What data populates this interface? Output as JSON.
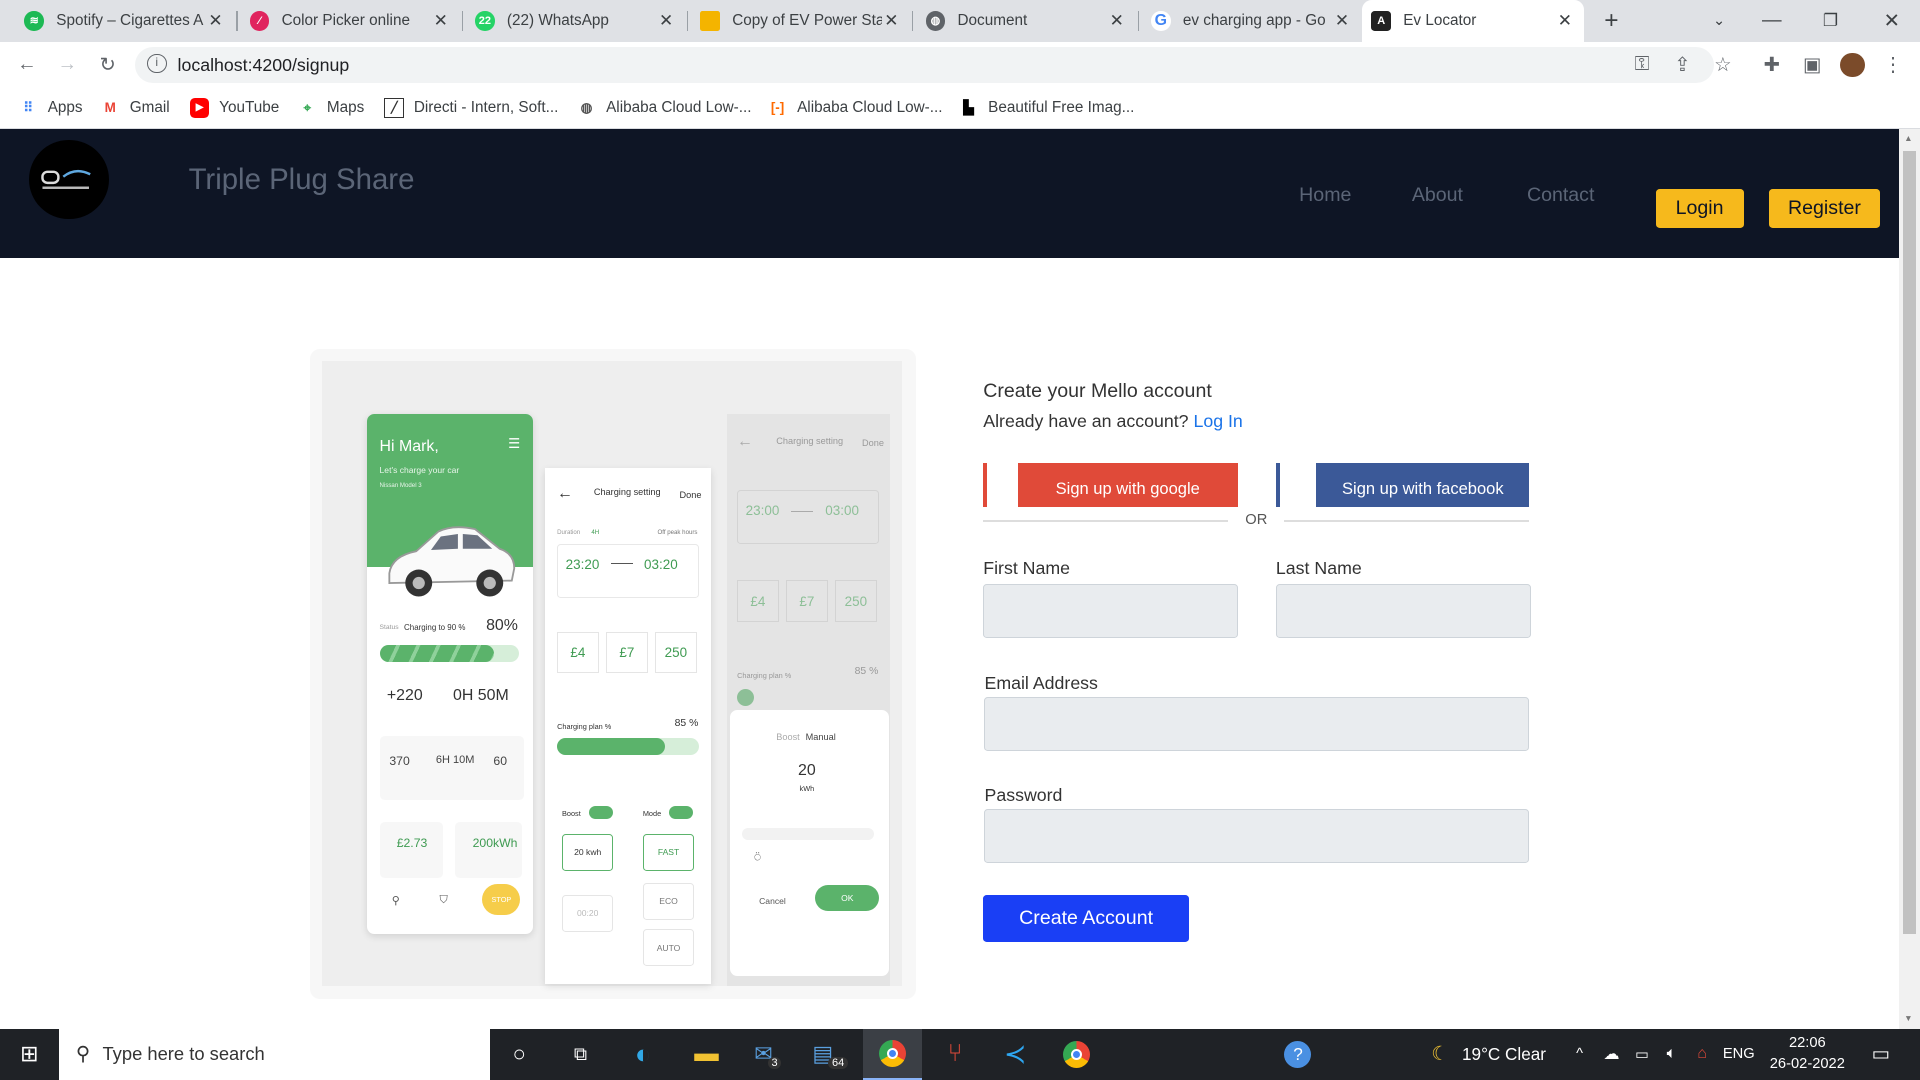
{
  "browser": {
    "tabs": [
      {
        "title": "Spotify – Cigarettes A",
        "icon": "spotify-icon",
        "color": "#1db954"
      },
      {
        "title": "Color Picker online",
        "icon": "color-picker-icon",
        "color": "#e0245e"
      },
      {
        "title": "(22) WhatsApp",
        "icon": "whatsapp-icon",
        "color": "#25d366",
        "badge": "22"
      },
      {
        "title": "Copy of EV Power Sta",
        "icon": "slides-icon",
        "color": "#f4b400"
      },
      {
        "title": "Document",
        "icon": "globe-icon",
        "color": "#5f6368"
      },
      {
        "title": "ev charging app - Go",
        "icon": "google-icon",
        "color": "#4285f4"
      },
      {
        "title": "Ev Locator",
        "icon": "angular-icon",
        "color": "#222"
      }
    ],
    "url": "localhost:4200/signup",
    "bookmarks": [
      {
        "label": "Apps",
        "icon": "apps-grid-icon"
      },
      {
        "label": "Gmail",
        "icon": "gmail-icon"
      },
      {
        "label": "YouTube",
        "icon": "youtube-icon"
      },
      {
        "label": "Maps",
        "icon": "maps-icon"
      },
      {
        "label": "Directi - Intern, Soft...",
        "icon": "directi-icon"
      },
      {
        "label": "Alibaba Cloud Low-...",
        "icon": "globe-icon"
      },
      {
        "label": "Alibaba Cloud Low-...",
        "icon": "alibaba-icon"
      },
      {
        "label": "Beautiful Free Imag...",
        "icon": "unsplash-icon"
      }
    ]
  },
  "app": {
    "brand": "Triple Plug Share",
    "nav": {
      "home": "Home",
      "about": "About",
      "contact": "Contact"
    },
    "login_label": "Login",
    "register_label": "Register"
  },
  "illustration": {
    "phone1": {
      "greeting": "Hi Mark,",
      "subtitle": "Let's charge your car",
      "car_model": "Nissan Model 3",
      "status_label": "Status",
      "status_text": "Charging to 90 %",
      "percent": "80%",
      "range_added": "+220",
      "time_left": "0H 50M",
      "stats": [
        "370",
        "6H 10M",
        "60"
      ],
      "cost": "£2.73",
      "energy": "200kWh",
      "stop_label": "STOP"
    },
    "phone2": {
      "title": "Charging setting",
      "done": "Done",
      "duration_label": "Duration",
      "duration": "4H",
      "offpeak": "Off peak hours",
      "start_time": "23:20",
      "end_time": "03:20",
      "prices": [
        "£4",
        "£7",
        "250"
      ],
      "plan_label": "Charging plan %",
      "plan_value": "85 %",
      "boost_label": "Boost",
      "mode_label": "Mode",
      "kwh_box": "20 kwh",
      "fast": "FAST",
      "eco": "ECO",
      "auto": "AUTO",
      "manual_time": "00:20"
    },
    "phone3": {
      "title": "Charging setting",
      "done": "Done",
      "start_time": "23:00",
      "end_time": "03:00",
      "prices": [
        "£4",
        "£7",
        "250"
      ],
      "plan_label": "Charging plan %",
      "plan_value": "85 %",
      "dialog_boost": "Boost",
      "dialog_manual": "Manual",
      "dialog_value": "20",
      "dialog_unit": "kWh",
      "cancel": "Cancel",
      "ok": "OK"
    }
  },
  "form": {
    "heading": "Create your Mello account",
    "have_account": "Already have an account?",
    "login_link": "Log In",
    "google_label": "Sign up with google",
    "facebook_label": "Sign up with facebook",
    "or_label": "OR",
    "first_name_label": "First Name",
    "last_name_label": "Last Name",
    "email_label": "Email Address",
    "password_label": "Password",
    "submit_label": "Create Account",
    "colors": {
      "google": "#e04a39",
      "facebook": "#3b5998",
      "submit": "#1a3ff5",
      "accent": "#f6b91c"
    }
  },
  "taskbar": {
    "search_placeholder": "Type here to search",
    "weather": "19°C  Clear",
    "language": "ENG",
    "time": "22:06",
    "date": "26-02-2022",
    "mail_badge": "3",
    "files_badge": "64"
  }
}
